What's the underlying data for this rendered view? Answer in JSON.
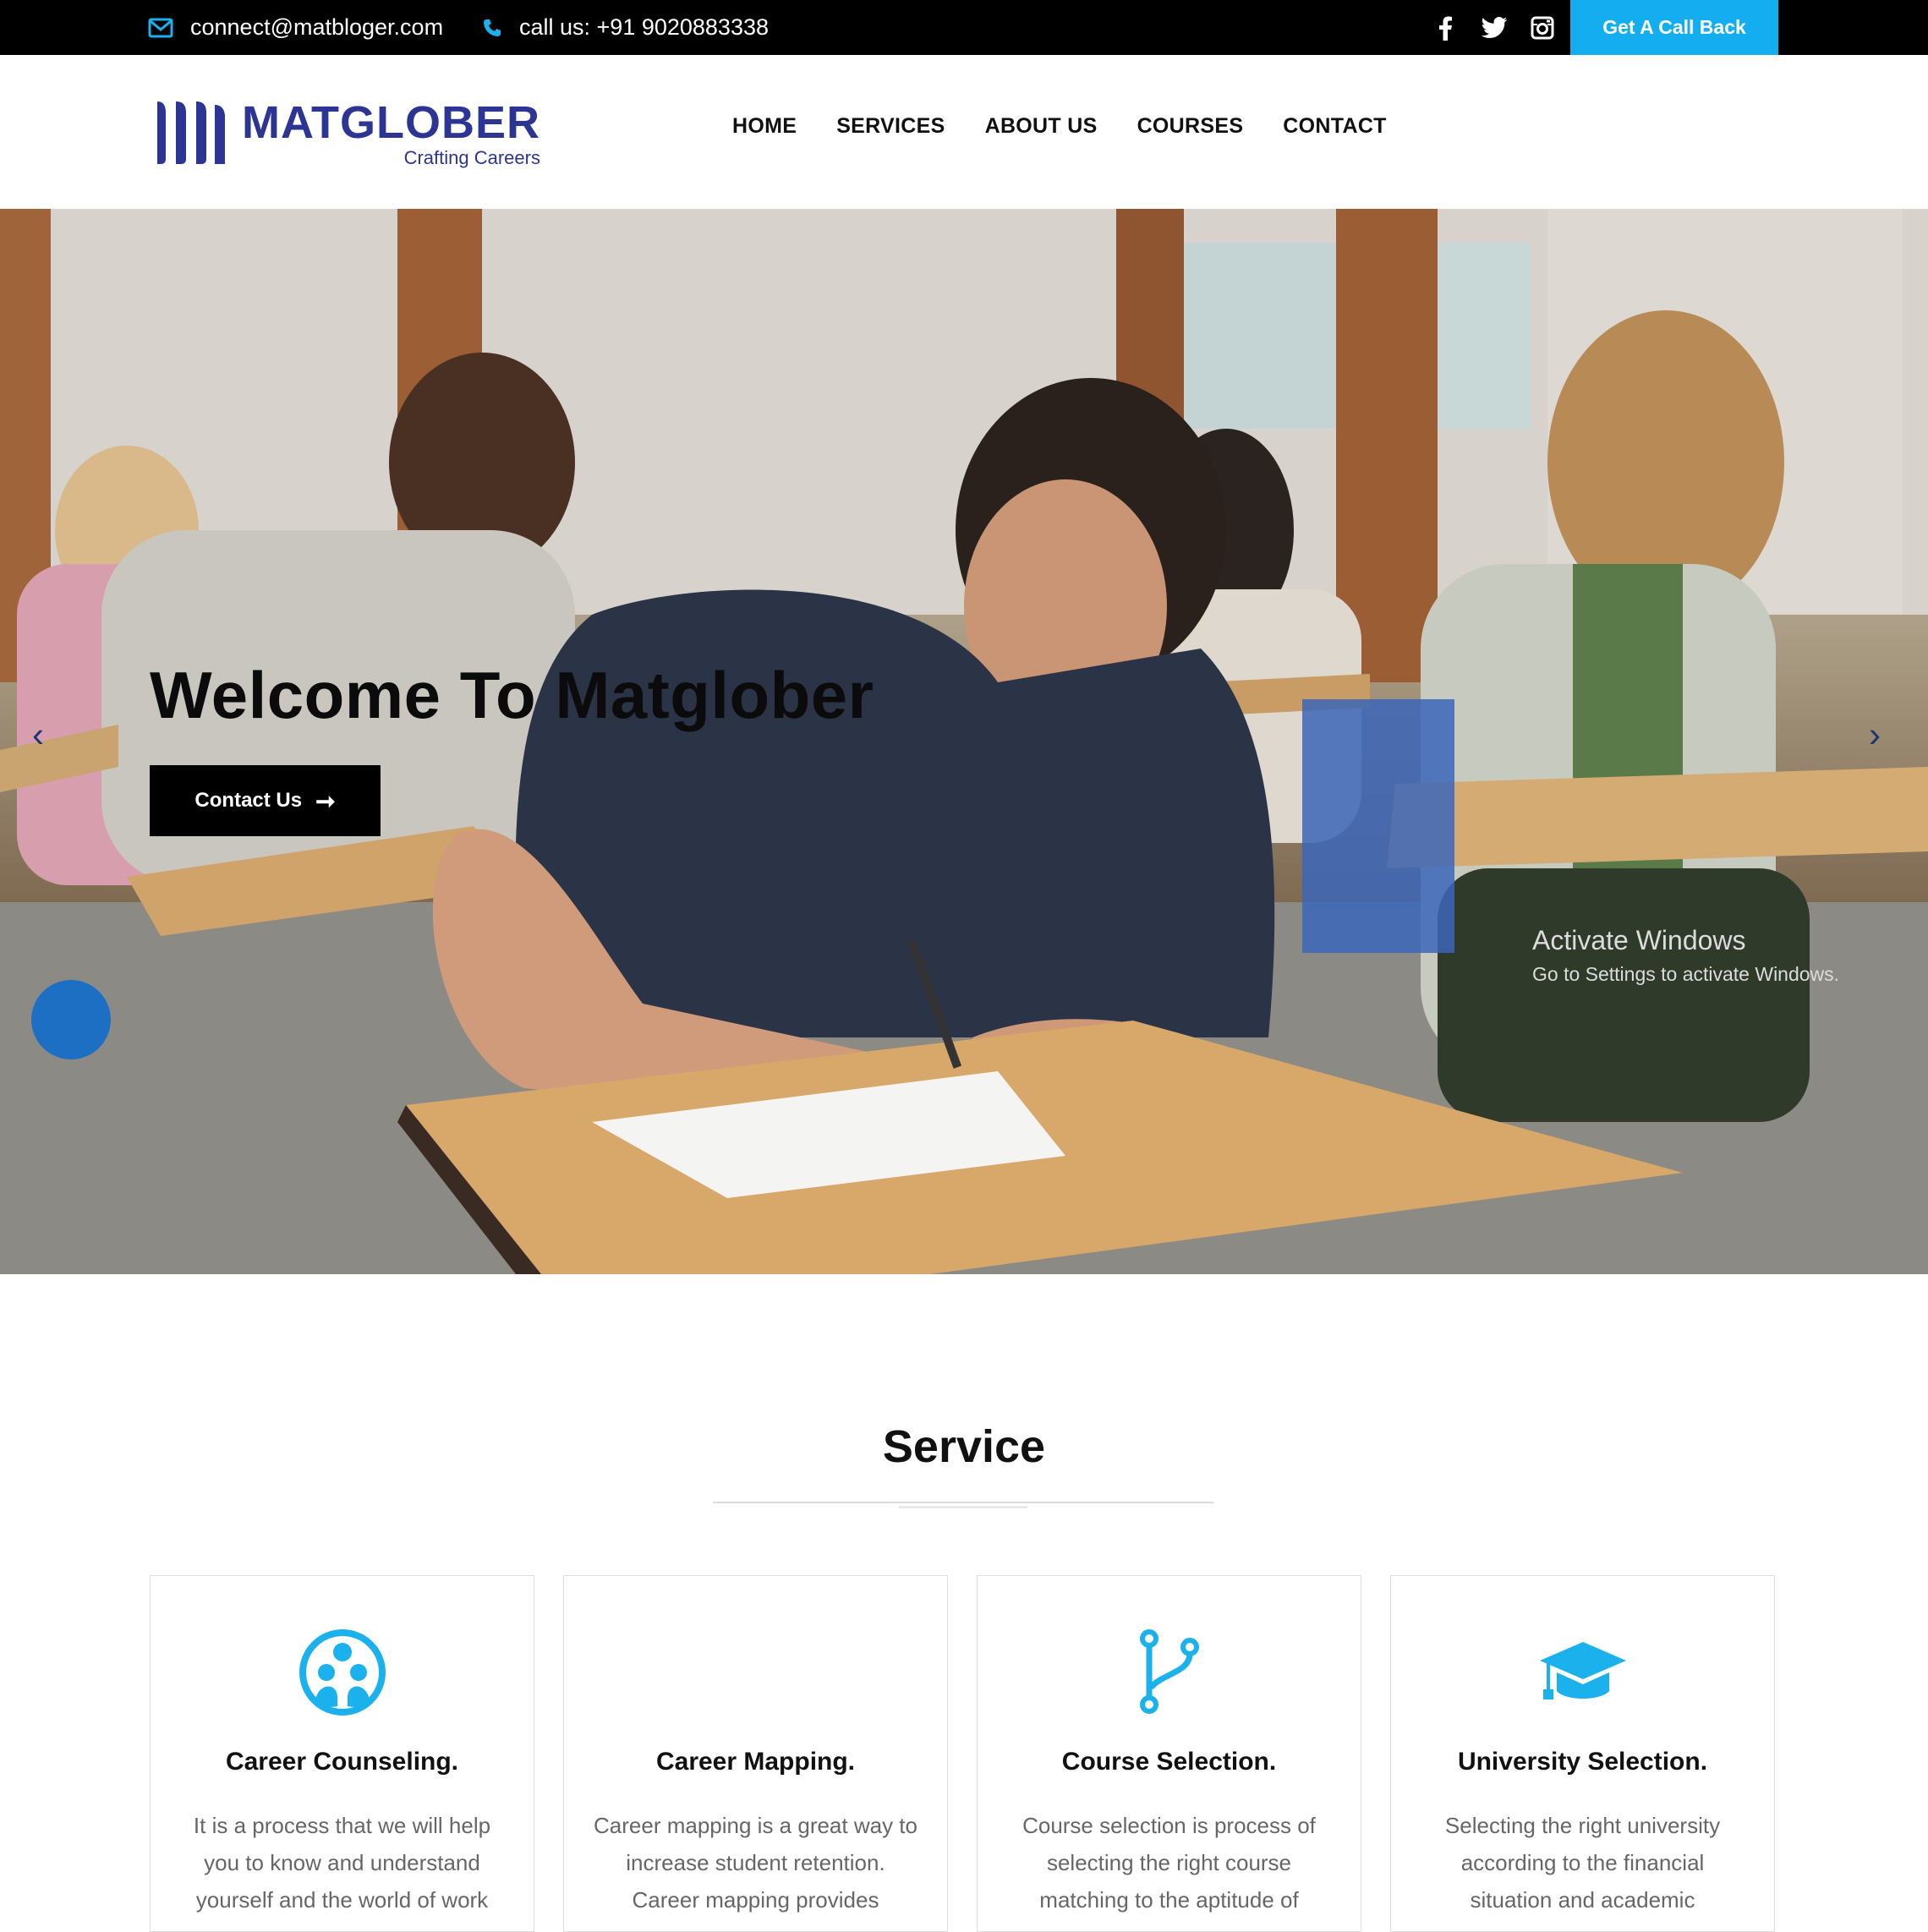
{
  "topbar": {
    "email": "connect@matbloger.com",
    "phone": "call us: +91 9020883338",
    "callback_label": "Get A Call Back",
    "social_icons": [
      "facebook-icon",
      "twitter-icon",
      "instagram-icon"
    ]
  },
  "logo": {
    "name": "MATGLOBER",
    "tagline": "Crafting Careers"
  },
  "nav": {
    "items": [
      "HOME",
      "SERVICES",
      "ABOUT US",
      "COURSES",
      "CONTACT"
    ]
  },
  "hero": {
    "title": "Welcome To Matglober",
    "button_label": "Contact Us",
    "prev_arrow": "‹",
    "next_arrow": "›"
  },
  "watermark": {
    "title": "Activate Windows",
    "subtitle": "Go to Settings to activate Windows."
  },
  "services": {
    "title": "Service",
    "cards": [
      {
        "title": "Career Counseling.",
        "text": "It is a process that we will help you to know and understand yourself and the world of work",
        "icon": "people-circle-icon"
      },
      {
        "title": "Career Mapping.",
        "text": "Career mapping is a great way to increase student retention. Career mapping provides",
        "icon": ""
      },
      {
        "title": "Course Selection.",
        "text": "Course selection is process of selecting the right course matching to the aptitude of",
        "icon": "branch-icon"
      },
      {
        "title": "University Selection.",
        "text": "Selecting the right university according to the financial situation and academic",
        "icon": "graduation-cap-icon"
      }
    ]
  },
  "colors": {
    "accent": "#14aef0",
    "brand": "#2c3593",
    "topbar": "#000000"
  }
}
